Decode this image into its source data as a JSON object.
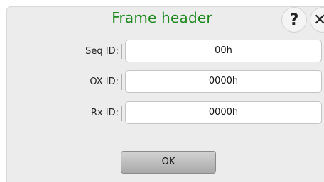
{
  "dialog": {
    "title": "Frame header",
    "help_icon": "question-mark",
    "close_icon": "close-x",
    "fields": [
      {
        "label": "Seq ID:",
        "value": "00h"
      },
      {
        "label": "OX ID:",
        "value": "0000h"
      },
      {
        "label": "Rx ID:",
        "value": "0000h"
      }
    ],
    "ok_label": "OK"
  },
  "colors": {
    "title": "#1e8a1e",
    "dialog_background": "#ececec"
  }
}
